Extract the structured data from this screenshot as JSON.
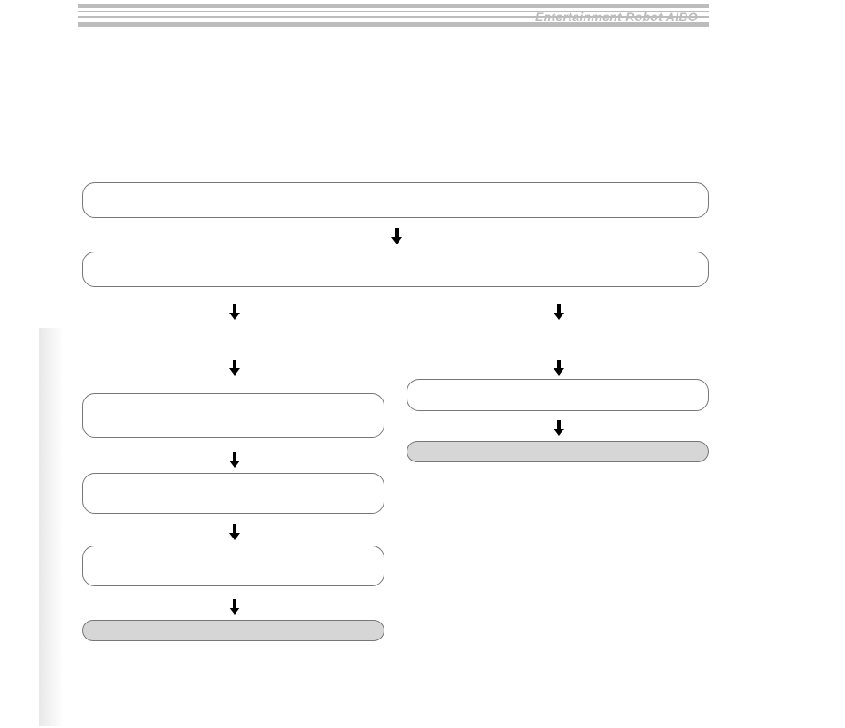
{
  "header": {
    "title": "Entertainment Robot AIBO"
  },
  "flow": {
    "box_top1": "",
    "box_top2": "",
    "box_left_a": "",
    "box_left_b": "",
    "box_left_c": "",
    "box_left_end": "",
    "box_right_a": "",
    "box_right_end": ""
  }
}
